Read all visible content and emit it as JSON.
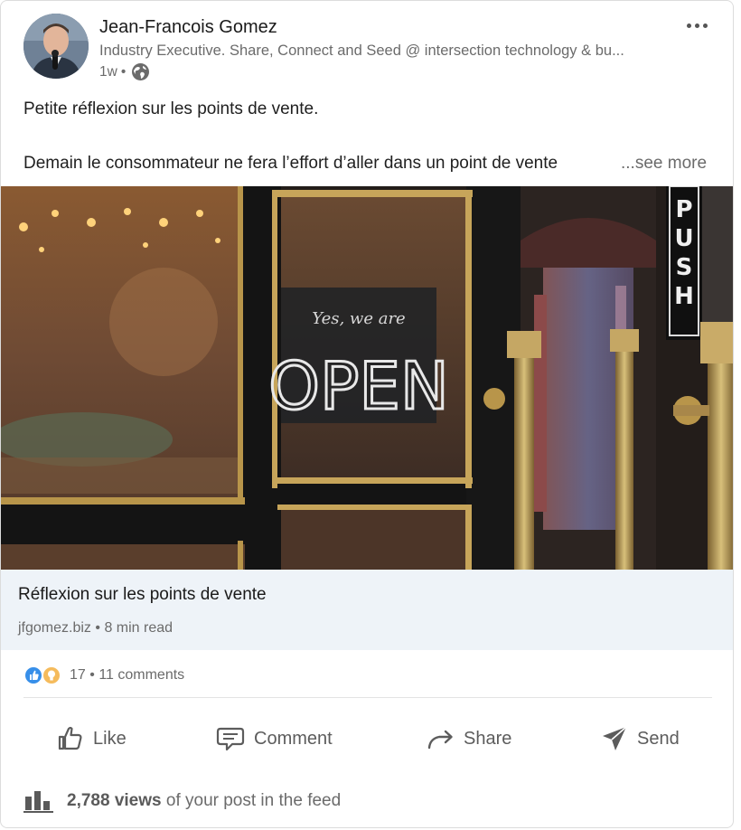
{
  "author": {
    "name": "Jean-Francois Gomez",
    "headline": "Industry Executive. Share, Connect and Seed @ intersection technology & bu...",
    "time": "1w",
    "separator": "•"
  },
  "post": {
    "line1": "Petite réflexion sur les points de vente.",
    "line2": "Demain le consommateur ne fera l’effort d’aller dans un point de vente",
    "see_more": "...see more"
  },
  "image": {
    "sign_script": "Yes, we are",
    "sign_main": "OPEN",
    "push": "PUSH"
  },
  "link": {
    "title": "Réflexion sur les points de vente",
    "domain": "jfgomez.biz",
    "separator": "•",
    "read_time": "8 min read"
  },
  "social": {
    "reaction_count": "17",
    "separator": "•",
    "comments": "11 comments"
  },
  "actions": {
    "like": "Like",
    "comment": "Comment",
    "share": "Share",
    "send": "Send"
  },
  "views": {
    "count": "2,788 views",
    "suffix": "of your post in the feed"
  },
  "colors": {
    "like_blue": "#378fe9",
    "insight_yellow": "#f5bb5c",
    "link_bar_bg": "#eef3f8",
    "text_gray": "#6b6b6b"
  }
}
